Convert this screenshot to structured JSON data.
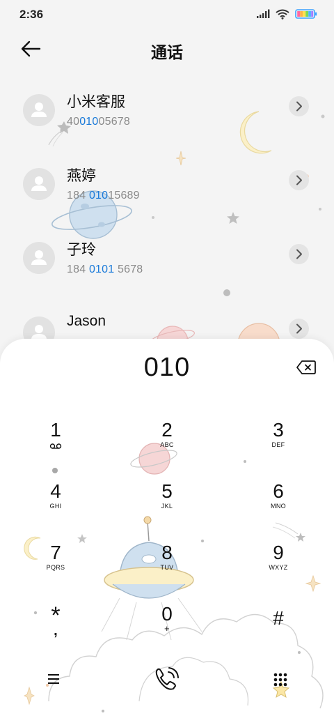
{
  "status": {
    "time": "2:36"
  },
  "header": {
    "title": "通话"
  },
  "contacts": [
    {
      "name": "小米客服",
      "num_pre": "40",
      "num_hl": "010",
      "num_post": "05678"
    },
    {
      "name": "燕婷",
      "num_pre": "184 ",
      "num_hl": "010",
      "num_post": "15689"
    },
    {
      "name": "子玲",
      "num_pre": "184 ",
      "num_hl": "0101",
      "num_post": " 5678"
    },
    {
      "name": "Jason",
      "num_pre": "",
      "num_hl": "",
      "num_post": ""
    }
  ],
  "dialer": {
    "typed": "010",
    "keys": [
      {
        "digit": "1",
        "letters": ""
      },
      {
        "digit": "2",
        "letters": "ABC"
      },
      {
        "digit": "3",
        "letters": "DEF"
      },
      {
        "digit": "4",
        "letters": "GHI"
      },
      {
        "digit": "5",
        "letters": "JKL"
      },
      {
        "digit": "6",
        "letters": "MNO"
      },
      {
        "digit": "7",
        "letters": "PQRS"
      },
      {
        "digit": "8",
        "letters": "TUV"
      },
      {
        "digit": "9",
        "letters": "WXYZ"
      },
      {
        "digit": "*",
        "letters": ","
      },
      {
        "digit": "0",
        "letters": "+"
      },
      {
        "digit": "#",
        "letters": ""
      }
    ]
  },
  "icons": {
    "signal": "signal-icon",
    "wifi": "wifi-icon",
    "battery": "battery-icon",
    "back": "back-arrow-icon",
    "chevron": "chevron-right-icon",
    "voicemail": "voicemail-icon",
    "backspace": "backspace-icon",
    "menu": "menu-icon",
    "call": "call-icon",
    "keypad": "keypad-toggle-icon"
  },
  "colors": {
    "highlight": "#1a7ad9",
    "background": "#f4f4f4",
    "sheet": "#ffffff"
  }
}
